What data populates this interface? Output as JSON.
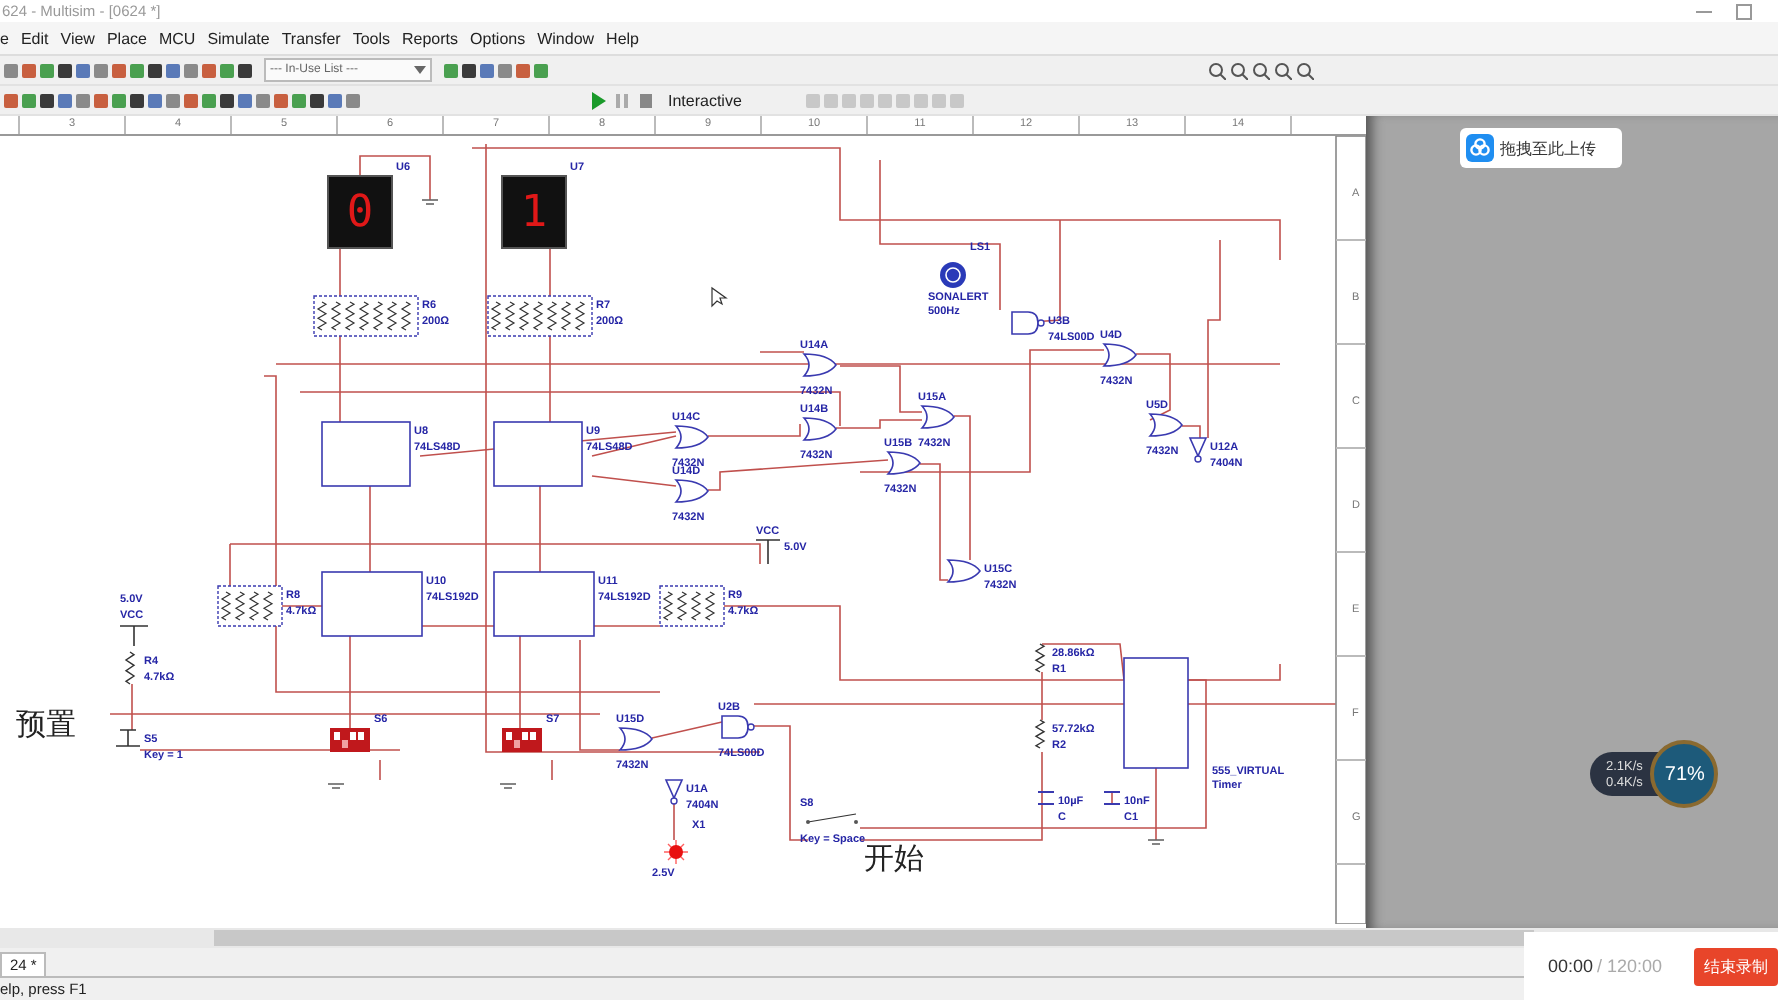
{
  "window": {
    "title": "624 - Multisim - [0624 *]"
  },
  "menu": [
    {
      "label": "e"
    },
    {
      "label": "Edit"
    },
    {
      "label": "View"
    },
    {
      "label": "Place"
    },
    {
      "label": "MCU"
    },
    {
      "label": "Simulate"
    },
    {
      "label": "Transfer"
    },
    {
      "label": "Tools"
    },
    {
      "label": "Reports"
    },
    {
      "label": "Options"
    },
    {
      "label": "Window"
    },
    {
      "label": "Help"
    }
  ],
  "toolbar": {
    "list_dropdown": "--- In-Use List ---",
    "mode": "Interactive"
  },
  "ruler": {
    "columns": [
      "3",
      "4",
      "5",
      "6",
      "7",
      "8",
      "9",
      "10",
      "11",
      "12",
      "13",
      "14"
    ],
    "rows": [
      "A",
      "B",
      "C",
      "D",
      "E",
      "F",
      "G"
    ]
  },
  "components": [
    {
      "kind": "display",
      "labels": [
        "U6"
      ],
      "digit": "0"
    },
    {
      "kind": "display",
      "labels": [
        "U7"
      ],
      "digit": "1"
    },
    {
      "kind": "resistor_pack",
      "labels": [
        "R6",
        "200Ω"
      ]
    },
    {
      "kind": "resistor_pack",
      "labels": [
        "R7",
        "200Ω"
      ]
    },
    {
      "kind": "chip",
      "labels": [
        "U8",
        "74LS48D"
      ]
    },
    {
      "kind": "chip",
      "labels": [
        "U9",
        "74LS48D"
      ]
    },
    {
      "kind": "chip",
      "labels": [
        "U10",
        "74LS192D"
      ]
    },
    {
      "kind": "chip",
      "labels": [
        "U11",
        "74LS192D"
      ]
    },
    {
      "kind": "resistor_pack",
      "labels": [
        "R8",
        "4.7kΩ"
      ]
    },
    {
      "kind": "resistor_pack",
      "labels": [
        "R9",
        "4.7kΩ"
      ]
    },
    {
      "kind": "dip_switch",
      "labels": [
        "S6"
      ],
      "switches": [
        {
          "on": true
        },
        {
          "on": false
        },
        {
          "on": true
        },
        {
          "on": true
        }
      ]
    },
    {
      "kind": "dip_switch",
      "labels": [
        "S7"
      ],
      "switches": [
        {
          "on": true
        },
        {
          "on": false
        },
        {
          "on": true
        },
        {
          "on": true
        }
      ]
    },
    {
      "kind": "or_gate",
      "labels": [
        "U14A",
        "7432N"
      ]
    },
    {
      "kind": "or_gate",
      "labels": [
        "U14B",
        "7432N"
      ]
    },
    {
      "kind": "or_gate",
      "labels": [
        "U14C",
        "7432N"
      ]
    },
    {
      "kind": "or_gate",
      "labels": [
        "U14D",
        "7432N"
      ]
    },
    {
      "kind": "or_gate",
      "labels": [
        "U15A",
        "7432N"
      ]
    },
    {
      "kind": "or_gate",
      "labels": [
        "U15B",
        "7432N"
      ]
    },
    {
      "kind": "or_gate",
      "labels": [
        "U15C",
        "7432N"
      ]
    },
    {
      "kind": "or_gate",
      "labels": [
        "U15D",
        "7432N"
      ]
    },
    {
      "kind": "nand_gate",
      "labels": [
        "U3B",
        "74LS00D"
      ]
    },
    {
      "kind": "or_gate",
      "labels": [
        "U4D",
        "7432N"
      ]
    },
    {
      "kind": "or_gate",
      "labels": [
        "U5D",
        "7432N"
      ]
    },
    {
      "kind": "inverter",
      "labels": [
        "U12A",
        "7404N"
      ]
    },
    {
      "kind": "nand_gate",
      "labels": [
        "U2B",
        "74LS00D"
      ]
    },
    {
      "kind": "inverter",
      "labels": [
        "U1A",
        "7404N"
      ]
    },
    {
      "kind": "buzzer",
      "labels": [
        "LS1",
        "SONALERT",
        "500Hz"
      ]
    },
    {
      "kind": "vcc",
      "labels": [
        "VCC",
        "5.0V"
      ]
    },
    {
      "kind": "vcc",
      "labels": [
        "5.0V",
        "VCC"
      ]
    },
    {
      "kind": "resistor",
      "labels": [
        "R4",
        "4.7kΩ"
      ]
    },
    {
      "kind": "pushbutton",
      "labels": [
        "S5",
        "Key = 1"
      ]
    },
    {
      "kind": "probe",
      "labels": [
        "X1",
        "2.5V"
      ]
    },
    {
      "kind": "switch",
      "labels": [
        "S8",
        "Key = Space"
      ]
    },
    {
      "kind": "timer",
      "labels": [
        "555_VIRTUAL",
        "Timer"
      ]
    },
    {
      "kind": "resistor",
      "labels": [
        "28.86kΩ",
        "R1"
      ]
    },
    {
      "kind": "resistor",
      "labels": [
        "57.72kΩ",
        "R2"
      ]
    },
    {
      "kind": "capacitor",
      "labels": [
        "10µF",
        "C"
      ]
    },
    {
      "kind": "capacitor",
      "labels": [
        "10nF",
        "C1"
      ]
    }
  ],
  "annotations": [
    "预置",
    "开始"
  ],
  "tabs": [
    {
      "label": "24 *",
      "selected": true
    }
  ],
  "status_bar": "elp, press F1",
  "upload_button": "拖拽至此上传",
  "network_widget": {
    "upload": "2.1K/s",
    "download": "0.4K/s",
    "usage": "71%"
  },
  "recording": {
    "elapsed": "00:00",
    "limit": "/ 120:00",
    "stop_button": "结束录制"
  }
}
